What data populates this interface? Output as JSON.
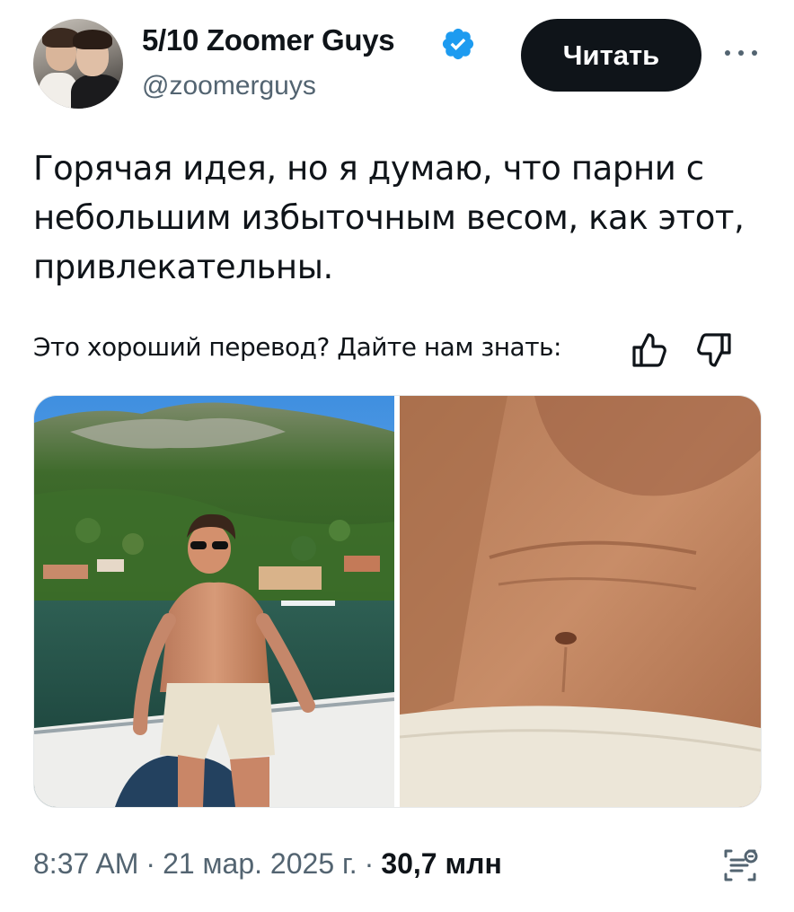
{
  "author": {
    "display_name": "5/10 Zoomer Guys",
    "handle": "@zoomerguys",
    "verified_icon": "verified-badge-icon",
    "verified_color": "#1d9bf0"
  },
  "header": {
    "read_button_label": "Читать",
    "more_icon": "more-dots-icon"
  },
  "tweet": {
    "text_lines": [
      "Горячая идея, но я думаю, что парни с",
      "небольшим избыточным весом, как этот,",
      "привлекательны."
    ]
  },
  "translation_feedback": {
    "prompt": "Это хороший перевод? Дайте нам знать:",
    "thumbs_up_icon": "thumbs-up-icon",
    "thumbs_down_icon": "thumbs-down-icon"
  },
  "media": {
    "left_image": "photo-man-on-boat-at-lake",
    "right_image": "photo-abdomen-closeup"
  },
  "footer": {
    "time": "8:37 AM",
    "date": "21 мар. 2025 г.",
    "separator": "·",
    "views": "30,7 млн",
    "grok_icon": "grok-analyze-icon"
  },
  "colors": {
    "text_primary": "#0f1419",
    "text_secondary": "#536471",
    "button_bg": "#0f1419"
  }
}
